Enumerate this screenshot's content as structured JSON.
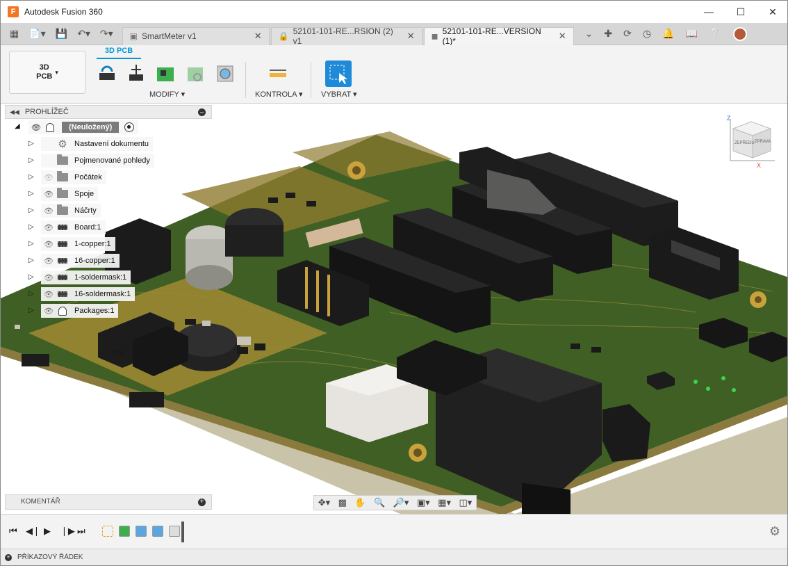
{
  "window": {
    "title": "Autodesk Fusion 360",
    "logo_letter": "F"
  },
  "tabs": [
    {
      "label": "SmartMeter v1",
      "active": false
    },
    {
      "label": "52101-101-RE...RSION (2) v1",
      "active": false
    },
    {
      "label": "52101-101-RE...VERSION (1)*",
      "active": true
    }
  ],
  "ribbon": {
    "workspace_label": "3D\nPCB",
    "active_tab": "3D PCB",
    "groups": {
      "modify": "MODIFY",
      "inspect": "KONTROLA",
      "select": "VYBRAT"
    }
  },
  "browser": {
    "title": "PROHLÍŽEČ",
    "root_label": "(Neuložený)",
    "items": [
      {
        "label": "Nastavení dokumentu",
        "icon": "gear-icon"
      },
      {
        "label": "Pojmenované pohledy",
        "icon": "folder-icon"
      },
      {
        "label": "Počátek",
        "icon": "folder-icon",
        "hidden": true
      },
      {
        "label": "Spoje",
        "icon": "folder-icon"
      },
      {
        "label": "Náčrty",
        "icon": "folder-icon"
      },
      {
        "label": "Board:1",
        "icon": "chip-icon"
      },
      {
        "label": "1-copper:1",
        "icon": "chip-icon"
      },
      {
        "label": "16-copper:1",
        "icon": "chip-icon"
      },
      {
        "label": "1-soldermask:1",
        "icon": "chip-icon"
      },
      {
        "label": "16-soldermask:1",
        "icon": "chip-icon"
      },
      {
        "label": "Packages:1",
        "icon": "package-icon"
      }
    ]
  },
  "comments": {
    "title": "KOMENTÁŘ"
  },
  "viewcube": {
    "z": "Z",
    "x": "X",
    "front": "ZEPŘEDU",
    "right": "ZPRAVA"
  },
  "command_line": {
    "title": "PŘÍKAZOVÝ ŘÁDEK"
  },
  "colors": {
    "accent": "#0696d7",
    "pcb_green": "#3f5f24",
    "pcb_gold": "#a08a32",
    "component_black": "#1c1c1c"
  }
}
